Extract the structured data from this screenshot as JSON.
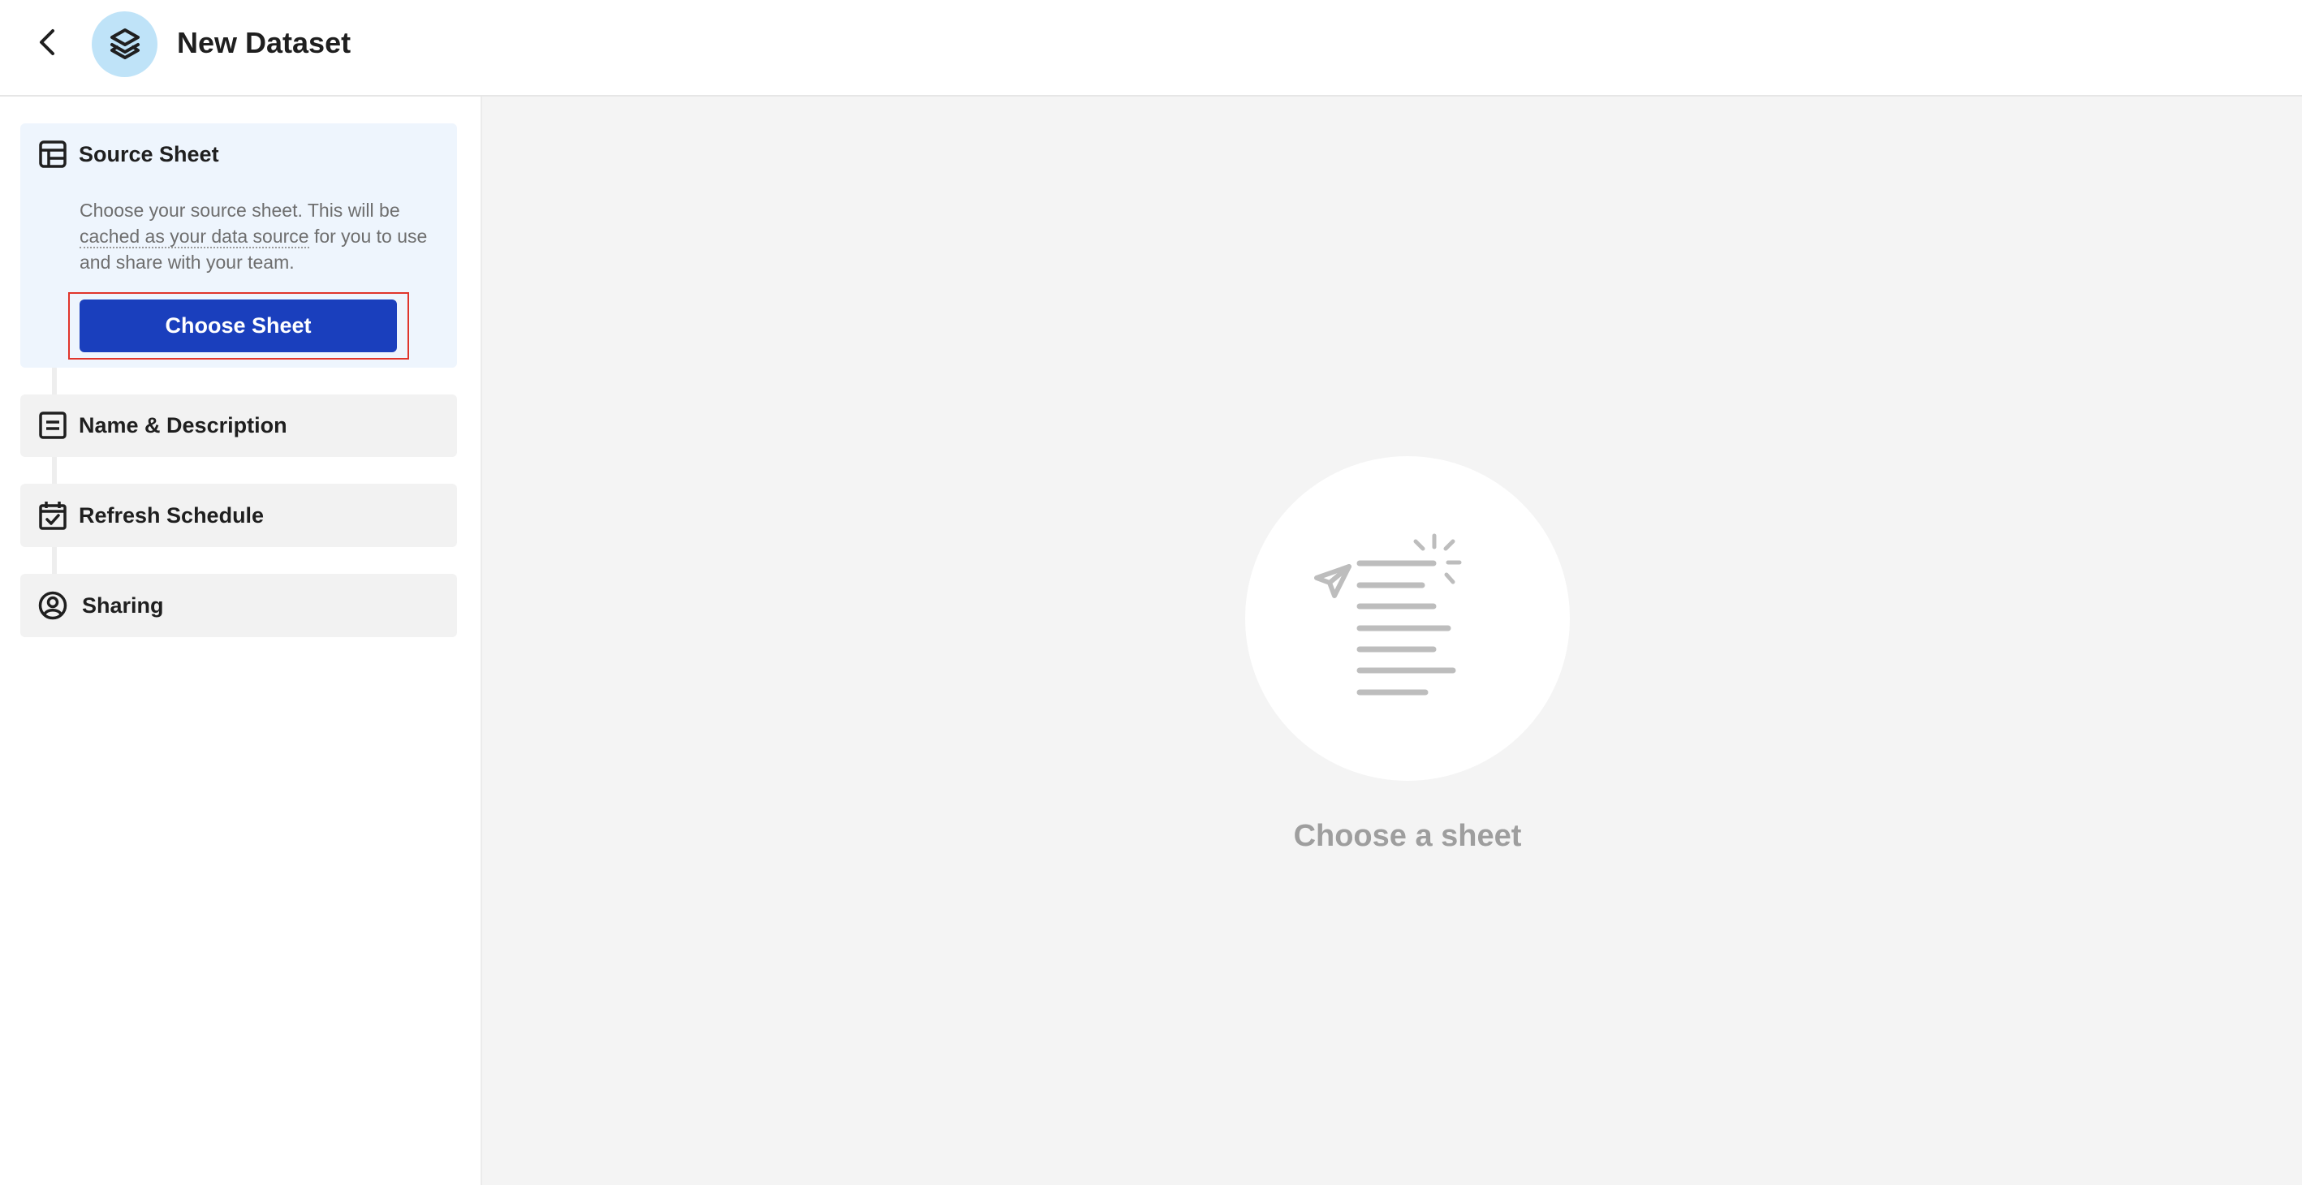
{
  "header": {
    "title": "New Dataset",
    "back_icon": "chevron-left-icon",
    "logo_icon": "layers-icon"
  },
  "sidebar": {
    "steps": [
      {
        "title": "Source Sheet",
        "icon": "table-icon",
        "active": true,
        "description_prefix": "Choose your source sheet. This will be ",
        "description_link": "cached as your data source",
        "description_suffix": " for you to use and share with your team.",
        "button_label": "Choose Sheet"
      },
      {
        "title": "Name & Description",
        "icon": "document-icon",
        "active": false
      },
      {
        "title": "Refresh Schedule",
        "icon": "calendar-check-icon",
        "active": false
      },
      {
        "title": "Sharing",
        "icon": "user-circle-icon",
        "active": false
      }
    ]
  },
  "main": {
    "empty_state_text": "Choose a sheet",
    "empty_state_icon": "send-document-icon"
  },
  "colors": {
    "primary_button": "#1a3fbd",
    "active_step_bg": "#eef5fd",
    "logo_bg": "#bfe3f8",
    "highlight_frame": "#e0352b"
  }
}
